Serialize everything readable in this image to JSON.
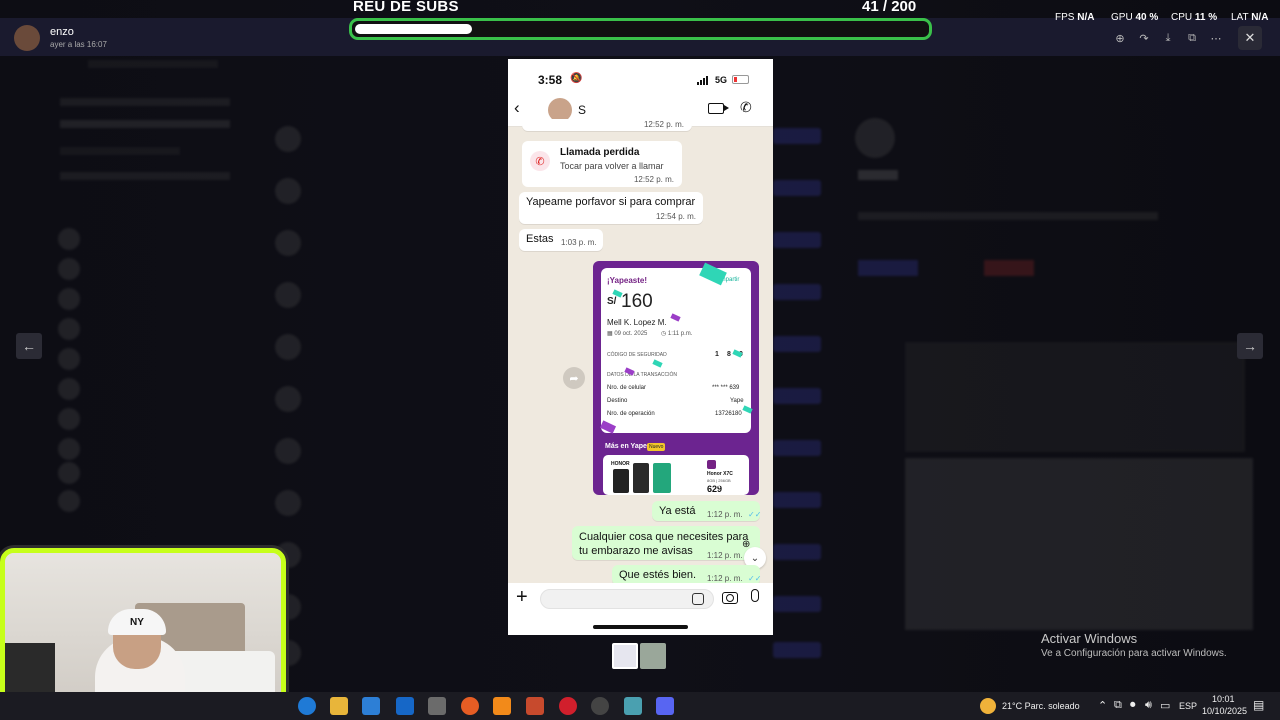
{
  "viewer": {
    "user_name": "enzo",
    "timestamp": "ayer a las 16:07"
  },
  "overlay": {
    "title": "REU DE SUBS",
    "count": "41",
    "goal": "/ 200",
    "progress_fraction": 0.205
  },
  "stats": [
    {
      "label": "FPS",
      "value": "N/A"
    },
    {
      "label": "GPU",
      "value": "40 %"
    },
    {
      "label": "CPU",
      "value": "11 %"
    },
    {
      "label": "LAT",
      "value": "N/A"
    }
  ],
  "phone": {
    "status_time": "3:58",
    "network": "5G",
    "contact_name": "S",
    "partial_time": "12:52 p. m.",
    "missed_call": {
      "title": "Llamada perdida",
      "subtitle": "Tocar para volver a llamar",
      "time": "12:52 p. m."
    },
    "messages": [
      {
        "text": "Yapeame porfavor si para comprar",
        "time": "12:54 p. m."
      },
      {
        "text": "Estas",
        "time": "1:03 p. m."
      }
    ],
    "receipt": {
      "heading": "¡Yapeaste!",
      "share": "Compartir",
      "currency": "S/",
      "amount": "160",
      "name": "Mell K. Lopez M.",
      "date": "09 oct. 2025",
      "time": "1:11 p.m.",
      "security_label": "CÓDIGO DE SEGURIDAD",
      "security_code": [
        "1",
        "8",
        "0"
      ],
      "section": "DATOS DE LA TRANSACCIÓN",
      "rows": [
        {
          "label": "Nro. de celular",
          "value": "*** *** 639"
        },
        {
          "label": "Destino",
          "value": "Yape"
        },
        {
          "label": "Nro. de operación",
          "value": "13726180"
        }
      ],
      "more": "Más en Yape",
      "badge": "Nuevo",
      "brand": "HONOR",
      "promo_model": "Honor X7C",
      "promo_specs": "8GB | 256GB",
      "promo_price": "629"
    },
    "sent": [
      {
        "text": "Ya está",
        "time": "1:12 p. m."
      },
      {
        "text": "Cualquier cosa que necesites para tu embarazo me avisas",
        "time": "1:12 p. m."
      },
      {
        "text": "Que estés bien.",
        "time": "1:12 p. m."
      }
    ]
  },
  "webcam": {
    "cap_logo": "NY"
  },
  "windows": {
    "activate_title": "Activar Windows",
    "activate_sub": "Ve a Configuración para activar Windows."
  },
  "taskbar": {
    "weather": "21°C  Parc. soleado",
    "lang": "ESP",
    "time": "10:01",
    "date": "10/10/2025"
  }
}
